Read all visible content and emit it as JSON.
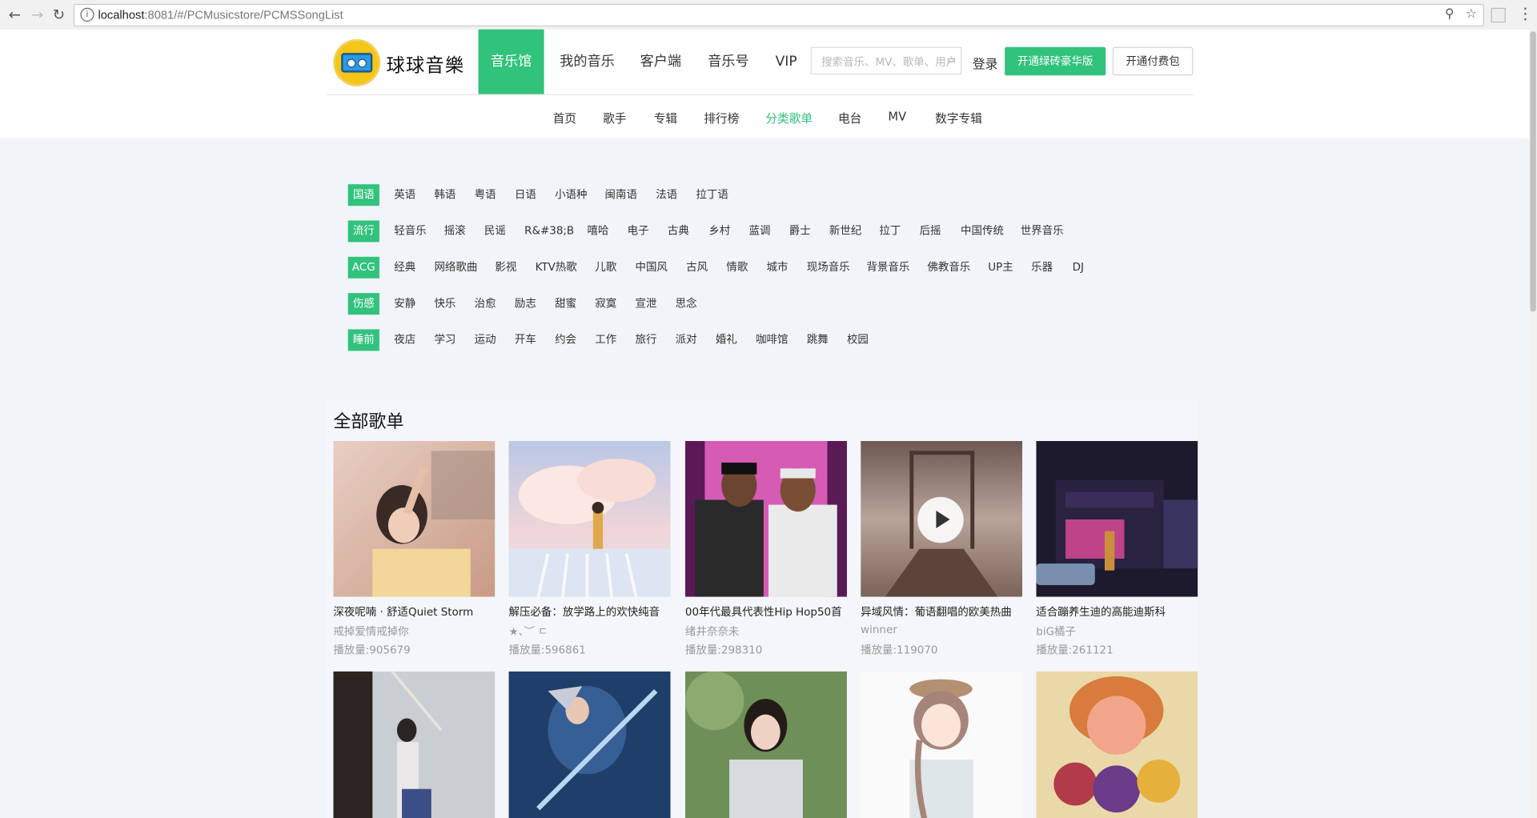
{
  "browser": {
    "url_host": "localhost",
    "url_path": ":8081/#/PCMusicstore/PCMSSongList"
  },
  "header": {
    "brand": "球球音樂",
    "nav": [
      "音乐馆",
      "我的音乐",
      "客户端",
      "音乐号",
      "VIP"
    ],
    "search_placeholder": "搜索音乐、MV、歌单、用户",
    "login": "登录",
    "btn_green": "开通绿砖豪华版",
    "btn_white": "开通付费包"
  },
  "subnav": [
    "首页",
    "歌手",
    "专辑",
    "排行榜",
    "分类歌单",
    "电台",
    "MV",
    "数字专辑"
  ],
  "tags": [
    {
      "head": "国语",
      "items": [
        "英语",
        "韩语",
        "粤语",
        "日语",
        "小语种",
        "闽南语",
        "法语",
        "拉丁语"
      ]
    },
    {
      "head": "流行",
      "items": [
        "轻音乐",
        "摇滚",
        "民谣",
        "R&#38;B",
        "嘻哈",
        "电子",
        "古典",
        "乡村",
        "蓝调",
        "爵士",
        "新世纪",
        "拉丁",
        "后摇",
        "中国传统",
        "世界音乐"
      ]
    },
    {
      "head": "ACG",
      "items": [
        "经典",
        "网络歌曲",
        "影视",
        "KTV热歌",
        "儿歌",
        "中国风",
        "古风",
        "情歌",
        "城市",
        "现场音乐",
        "背景音乐",
        "佛教音乐",
        "UP主",
        "乐器",
        "DJ"
      ]
    },
    {
      "head": "伤感",
      "items": [
        "安静",
        "快乐",
        "治愈",
        "励志",
        "甜蜜",
        "寂寞",
        "宣泄",
        "思念"
      ]
    },
    {
      "head": "睡前",
      "items": [
        "夜店",
        "学习",
        "运动",
        "开车",
        "约会",
        "工作",
        "旅行",
        "派对",
        "婚礼",
        "咖啡馆",
        "跳舞",
        "校园"
      ]
    }
  ],
  "section_title": "全部歌单",
  "playlists": [
    {
      "title": "深夜呢喃 · 舒适Quiet Storm",
      "creator": "戒掉爱情戒掉你",
      "plays": "播放量:905679"
    },
    {
      "title": "解压必备：放学路上的欢快纯音",
      "creator": "★、︶ ㄷ",
      "plays": "播放量:596861"
    },
    {
      "title": "00年代最具代表性Hip Hop50首",
      "creator": "绪井奈奈未",
      "plays": "播放量:298310"
    },
    {
      "title": "异域风情：葡语翻唱的欧美热曲",
      "creator": "winner",
      "plays": "播放量:119070"
    },
    {
      "title": "适合蹦养生迪的高能迪斯科",
      "creator": "biG橘子",
      "plays": "播放量:261121"
    }
  ],
  "colors": {
    "accent": "#31c27c"
  }
}
